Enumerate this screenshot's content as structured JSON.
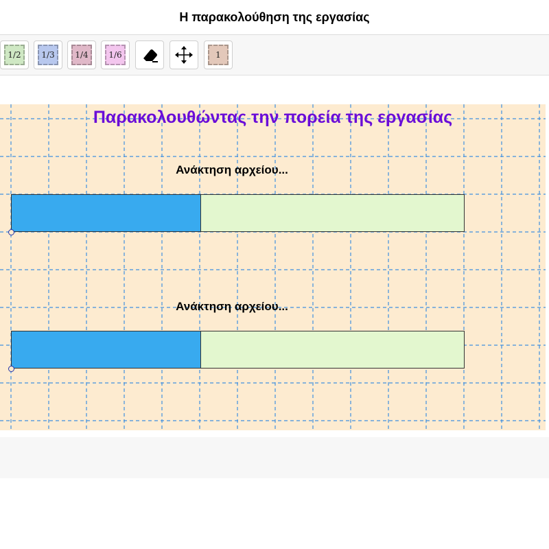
{
  "window": {
    "title": "Η παρακολούθηση της εργασίας"
  },
  "toolbar": {
    "tools": [
      {
        "label": "1/2",
        "color": "#cfe8c4"
      },
      {
        "label": "1/3",
        "color": "#b8c8ee"
      },
      {
        "label": "1/4",
        "color": "#e0b8c8"
      },
      {
        "label": "1/6",
        "color": "#f3c6ee"
      },
      {
        "icon": "eraser-icon"
      },
      {
        "icon": "move-icon"
      },
      {
        "label": "1",
        "color": "#e3c8ba"
      }
    ]
  },
  "canvas": {
    "heading": "Παρακολουθώντας την πορεία της εργασίας",
    "heading_color": "#6a0dd8",
    "progress_bars": [
      {
        "label": "Ανάκτηση αρχείου...",
        "progress": 0.4167
      },
      {
        "label": "Ανάκτηση αρχείου...",
        "progress": 0.4167
      }
    ],
    "fill_color": "#38aaef",
    "track_color": "#e3f7cf",
    "background_color": "#fdebd0",
    "grid_color": "#3f8fe0"
  }
}
